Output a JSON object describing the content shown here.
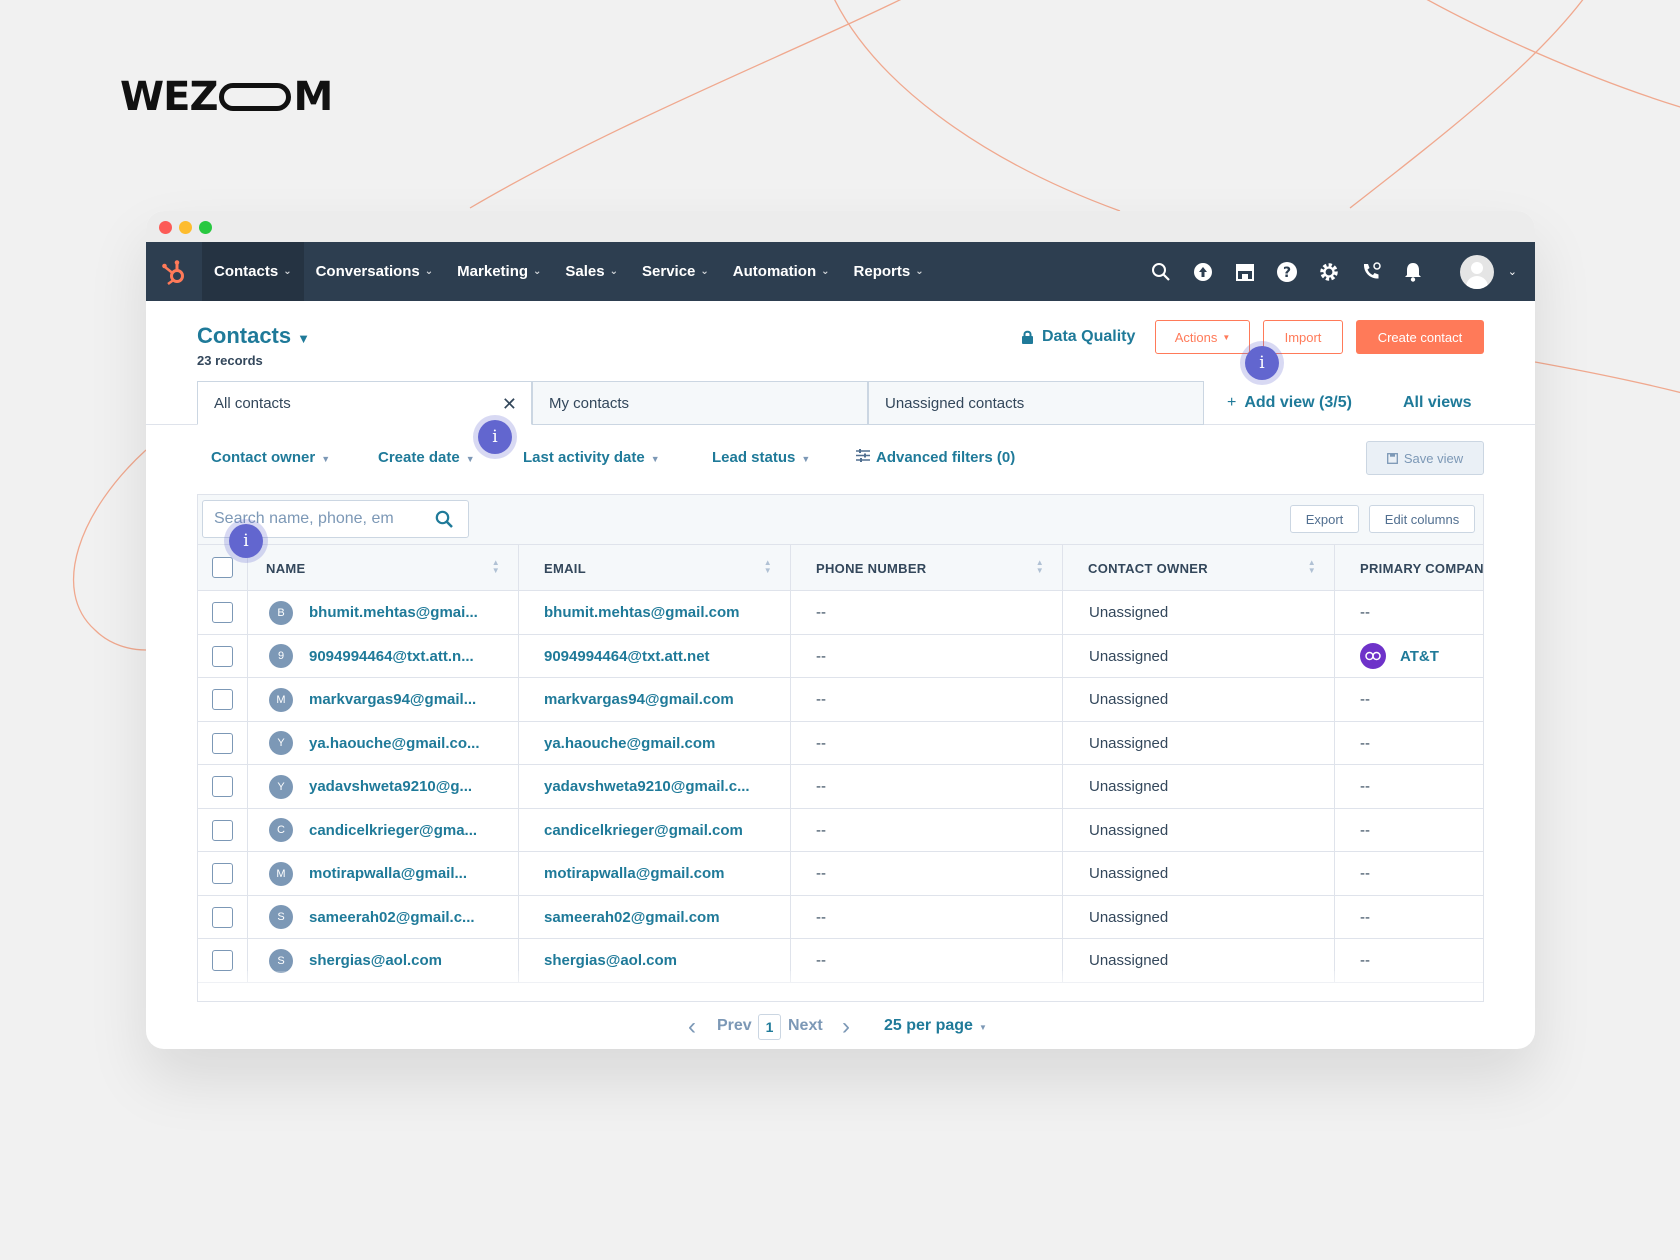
{
  "brand": {
    "logo_left": "WEZ",
    "logo_right": "M"
  },
  "nav": {
    "items": [
      {
        "label": "Contacts",
        "active": true
      },
      {
        "label": "Conversations"
      },
      {
        "label": "Marketing"
      },
      {
        "label": "Sales"
      },
      {
        "label": "Service"
      },
      {
        "label": "Automation"
      },
      {
        "label": "Reports"
      }
    ],
    "icons": [
      "search-icon",
      "upgrade-icon",
      "marketplace-icon",
      "help-icon",
      "settings-icon",
      "calling-icon",
      "notifications-icon"
    ]
  },
  "header": {
    "title": "Contacts",
    "records": "23 records",
    "data_quality": "Data Quality",
    "actions": "Actions",
    "import": "Import",
    "create": "Create contact"
  },
  "tabs": {
    "items": [
      "All contacts",
      "My contacts",
      "Unassigned contacts"
    ],
    "add_view": "Add view (3/5)",
    "all_views": "All views"
  },
  "filters": {
    "contact_owner": "Contact owner",
    "create_date": "Create date",
    "last_activity": "Last activity date",
    "lead_status": "Lead status",
    "advanced": "Advanced filters (0)",
    "save_view": "Save view"
  },
  "table": {
    "search_placeholder": "Search name, phone, em",
    "export": "Export",
    "edit_columns": "Edit columns",
    "columns": [
      "NAME",
      "EMAIL",
      "PHONE NUMBER",
      "CONTACT OWNER",
      "PRIMARY COMPANY"
    ],
    "rows": [
      {
        "initial": "B",
        "name": "bhumit.mehtas@gmai...",
        "email": "bhumit.mehtas@gmail.com",
        "phone": "--",
        "owner": "Unassigned",
        "company": "--"
      },
      {
        "initial": "9",
        "name": "9094994464@txt.att.n...",
        "email": "9094994464@txt.att.net",
        "phone": "--",
        "owner": "Unassigned",
        "company": "AT&T"
      },
      {
        "initial": "M",
        "name": "markvargas94@gmail...",
        "email": "markvargas94@gmail.com",
        "phone": "--",
        "owner": "Unassigned",
        "company": "--"
      },
      {
        "initial": "Y",
        "name": "ya.haouche@gmail.co...",
        "email": "ya.haouche@gmail.com",
        "phone": "--",
        "owner": "Unassigned",
        "company": "--"
      },
      {
        "initial": "Y",
        "name": "yadavshweta9210@g...",
        "email": "yadavshweta9210@gmail.c...",
        "phone": "--",
        "owner": "Unassigned",
        "company": "--"
      },
      {
        "initial": "C",
        "name": "candicelkrieger@gma...",
        "email": "candicelkrieger@gmail.com",
        "phone": "--",
        "owner": "Unassigned",
        "company": "--"
      },
      {
        "initial": "M",
        "name": "motirapwalla@gmail...",
        "email": "motirapwalla@gmail.com",
        "phone": "--",
        "owner": "Unassigned",
        "company": "--"
      },
      {
        "initial": "S",
        "name": "sameerah02@gmail.c...",
        "email": "sameerah02@gmail.com",
        "phone": "--",
        "owner": "Unassigned",
        "company": "--"
      },
      {
        "initial": "S",
        "name": "shergias@aol.com",
        "email": "shergias@aol.com",
        "phone": "--",
        "owner": "Unassigned",
        "company": "--"
      }
    ]
  },
  "pagination": {
    "prev": "Prev",
    "page": "1",
    "next": "Next",
    "per_page": "25 per page"
  },
  "hints": {
    "marker": "i"
  },
  "colors": {
    "nav_bg": "#2d3e50",
    "accent": "#ff7a59",
    "link": "#1f7a99",
    "hint": "#6266cf"
  }
}
